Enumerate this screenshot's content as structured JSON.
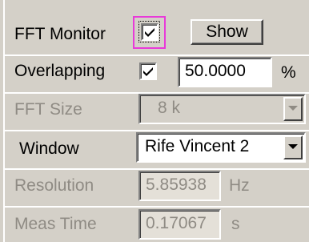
{
  "fft_monitor": {
    "label": "FFT Monitor",
    "checked": true,
    "show_button": "Show"
  },
  "overlapping": {
    "label": "Overlapping",
    "checked": true,
    "value": "50.0000",
    "unit": "%"
  },
  "fft_size": {
    "label": "FFT Size",
    "value": "8 k"
  },
  "window": {
    "label": "Window",
    "value": "Rife Vincent 2"
  },
  "resolution": {
    "label": "Resolution",
    "value": "5.85938",
    "unit": "Hz"
  },
  "meas_time": {
    "label": "Meas Time",
    "value": "0.17067",
    "unit": "s"
  },
  "colors": {
    "panel": "#d4d0c8",
    "disabled_text": "#8f8b84",
    "focus": "#e83ad9"
  },
  "icons": {
    "checkmark": "checkmark-icon",
    "dropdown": "dropdown-arrow-icon"
  }
}
